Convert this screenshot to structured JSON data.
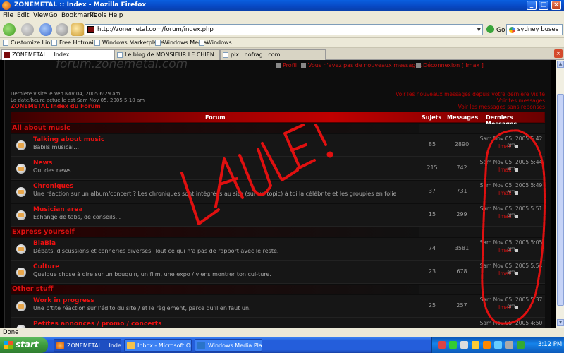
{
  "window": {
    "title": "ZONEMETAL :: Index - Mozilla Firefox"
  },
  "menu": [
    "File",
    "Edit",
    "View",
    "Go",
    "Bookmarks",
    "Tools",
    "Help"
  ],
  "nav": {
    "url": "http://zonemetal.com/forum/index.php",
    "go_label": "Go",
    "search_value": "sydney buses"
  },
  "bookmarks": [
    "Customize Links",
    "Free Hotmail",
    "Windows Marketplace",
    "Windows Media",
    "Windows"
  ],
  "tabs": [
    {
      "label": "ZONEMETAL :: Index",
      "active": true
    },
    {
      "label": "Le blog de MONSIEUR LE CHIEN",
      "active": false
    },
    {
      "label": "pix . nofrag . com",
      "active": false
    }
  ],
  "forum": {
    "logo": "forum.zonemetal.com",
    "toplinks": [
      "Profil",
      "Vous n'avez pas de nouveaux messages",
      "Déconnexion [ Imax ]"
    ],
    "last_visit": "Dernière visite le Ven Nov 04, 2005 6:29 am",
    "current_time": "La date/heure actuelle est Sam Nov 05, 2005 5:10 am",
    "breadcrumb": "ZONEMETAL Index du Forum",
    "right_links": [
      "Voir les nouveaux messages depuis votre dernière visite",
      "Voir tes messages",
      "Voir les messages sans réponses"
    ],
    "headers": {
      "forum": "Forum",
      "subjects": "Sujets",
      "messages": "Messages",
      "last": "Derniers Messages"
    },
    "categories": [
      {
        "name": "All about music",
        "forums": [
          {
            "name": "Talking about music",
            "desc": "Babils musical...",
            "subjects": "85",
            "messages": "2890",
            "last": "Sam Nov 05, 2005 5:42 am",
            "user": "Imax"
          },
          {
            "name": "News",
            "desc": "Oui des news.",
            "subjects": "215",
            "messages": "742",
            "last": "Sam Nov 05, 2005 5:44 am",
            "user": "Imax"
          },
          {
            "name": "Chroniques",
            "desc": "Une réaction sur un album/concert ? Les chroniques sont intégrées au site (sur un topic) à toi la célébrité et les groupies en folie",
            "subjects": "37",
            "messages": "731",
            "last": "Sam Nov 05, 2005 5:49 am",
            "user": "Imax"
          },
          {
            "name": "Musician area",
            "desc": "Echange de tabs, de conseils...",
            "subjects": "15",
            "messages": "299",
            "last": "Sam Nov 05, 2005 5:51 am",
            "user": "Imax"
          }
        ]
      },
      {
        "name": "Express yourself",
        "forums": [
          {
            "name": "BlaBla",
            "desc": "Débats, discussions et conneries diverses. Tout ce qui n'a pas de rapport avec le reste.",
            "subjects": "74",
            "messages": "3581",
            "last": "Sam Nov 05, 2005 5:05 am",
            "user": "Imax"
          },
          {
            "name": "Culture",
            "desc": "Quelque chose à dire sur un bouquin, un film, une expo / viens montrer ton cul-ture.",
            "subjects": "23",
            "messages": "678",
            "last": "Sam Nov 05, 2005 5:54 am",
            "user": "Imax"
          }
        ]
      },
      {
        "name": "Other stuff",
        "forums": [
          {
            "name": "Work in progress",
            "desc": "Une p'tite réaction sur l'édito du site / et le règlement, parce qu'il en faut un.",
            "subjects": "25",
            "messages": "257",
            "last": "Sam Nov 05, 2005 5:37 am",
            "user": "Imax"
          },
          {
            "name": "Petites annonces / promo / concerts",
            "desc": "",
            "subjects": "",
            "messages": "",
            "last": "Sam Nov 05, 2005 4:50 am",
            "user": ""
          }
        ]
      }
    ],
    "graffiti": "LAULE !"
  },
  "status": "Done",
  "taskbar": {
    "start": "start",
    "tasks": [
      "ZONEMETAL :: Index ...",
      "Inbox - Microsoft Out...",
      "Windows Media Player"
    ],
    "clock": "3:12 PM"
  }
}
